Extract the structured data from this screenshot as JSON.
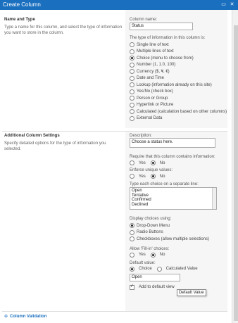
{
  "window": {
    "title": "Create Column",
    "controls": {
      "minimize": "▭",
      "close": "✕"
    }
  },
  "name_section": {
    "title": "Name and Type",
    "description": "Type a name for this column, and select the type of information you want to store in the column.",
    "column_name_label": "Column name:",
    "column_name_value": "Status",
    "type_label": "The type of information in this column is:",
    "types": [
      {
        "label": "Single line of text",
        "selected": false
      },
      {
        "label": "Multiple lines of text",
        "selected": false
      },
      {
        "label": "Choice (menu to choose from)",
        "selected": true
      },
      {
        "label": "Number (1, 1.0, 100)",
        "selected": false
      },
      {
        "label": "Currency ($, ¥, €)",
        "selected": false
      },
      {
        "label": "Date and Time",
        "selected": false
      },
      {
        "label": "Lookup (information already on this site)",
        "selected": false
      },
      {
        "label": "Yes/No (check box)",
        "selected": false
      },
      {
        "label": "Person or Group",
        "selected": false
      },
      {
        "label": "Hyperlink or Picture",
        "selected": false
      },
      {
        "label": "Calculated (calculation based on other columns)",
        "selected": false
      },
      {
        "label": "External Data",
        "selected": false
      }
    ]
  },
  "additional_section": {
    "title": "Additional Column Settings",
    "description": "Specify detailed options for the type of information you selected.",
    "description_label": "Description:",
    "description_value": "Choose a status here.",
    "require_label": "Require that this column contains information:",
    "require_yes": "Yes",
    "require_no": "No",
    "unique_label": "Enforce unique values:",
    "unique_yes": "Yes",
    "unique_no": "No",
    "choices_label": "Type each choice on a separate line:",
    "choices": [
      "Open",
      "Tentative",
      "Confirmed",
      "Declined"
    ],
    "display_label": "Display choices using:",
    "display_options": [
      {
        "label": "Drop-Down Menu",
        "selected": true
      },
      {
        "label": "Radio Buttons",
        "selected": false
      },
      {
        "label": "Checkboxes (allow multiple selections)",
        "selected": false
      }
    ],
    "fillin_label": "Allow 'Fill-in' choices:",
    "fillin_yes": "Yes",
    "fillin_no": "No",
    "default_label": "Default value:",
    "default_choice": "Choice",
    "default_calculated": "Calculated Value",
    "default_value": "Open",
    "tooltip": "Default Value",
    "add_to_view": "Add to default view"
  },
  "footer": {
    "validation_link": "Column Validation",
    "expand_icon": "⊕"
  }
}
